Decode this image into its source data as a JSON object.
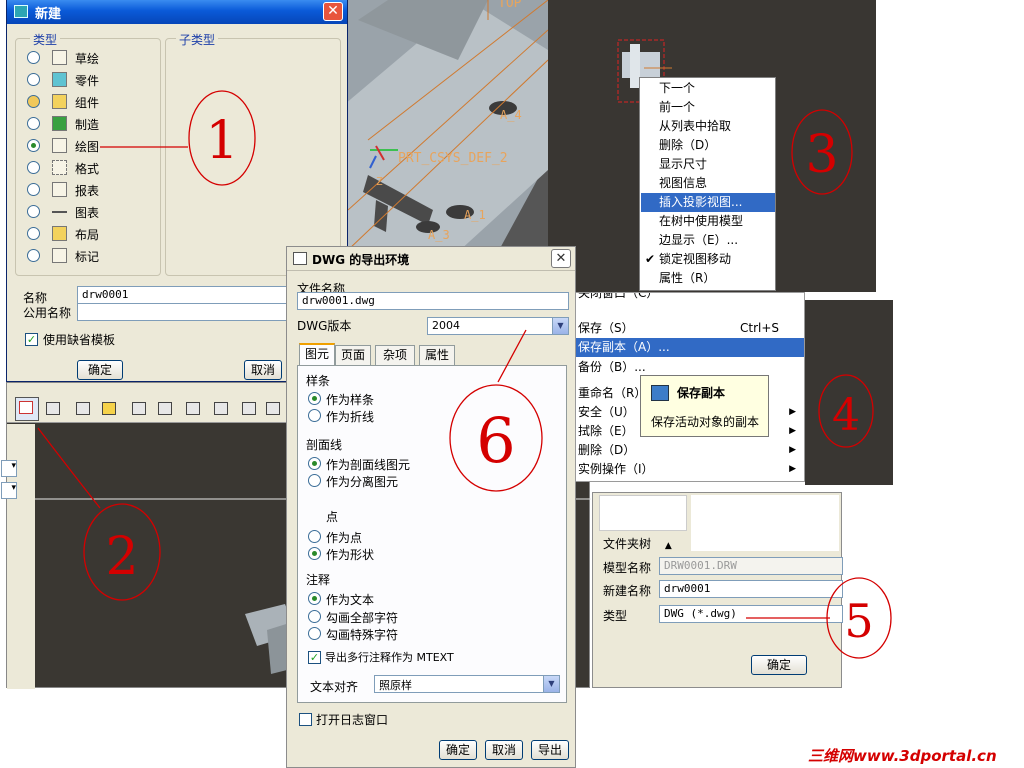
{
  "new_dialog": {
    "title": "新建",
    "type_group": "类型",
    "subtype_group": "子类型",
    "types": [
      "草绘",
      "零件",
      "组件",
      "制造",
      "绘图",
      "格式",
      "报表",
      "图表",
      "布局",
      "标记"
    ],
    "selected_type": "绘图",
    "name_label": "名称",
    "name_value": "drw0001",
    "common_name_label": "公用名称",
    "common_name_value": "",
    "use_template_label": "使用缺省模板",
    "use_template_checked": true,
    "ok": "确定",
    "cancel": "取消"
  },
  "model_view": {
    "labels": [
      "TOP",
      "PRT_CSYS_DEF_2",
      "A_4",
      "A_1",
      "A_3",
      "Z"
    ]
  },
  "context_menu": {
    "items": [
      "下一个",
      "前一个",
      "从列表中拾取",
      "删除（D）",
      "显示尺寸",
      "视图信息",
      "插入投影视图...",
      "在树中使用模型",
      "边显示（E）...",
      "锁定视图移动",
      "属性（R）"
    ],
    "highlighted": "插入投影视图...",
    "checked": "锁定视图移动"
  },
  "dwg_dialog": {
    "title": "DWG 的导出环境",
    "file_name_label": "文件名称",
    "file_name_value": "drw0001.dwg",
    "version_label": "DWG版本",
    "version_value": "2004",
    "tabs": [
      "图元",
      "页面",
      "杂项",
      "属性"
    ],
    "active_tab": "图元",
    "spline_section": "样条",
    "spline_opts": [
      "作为样条",
      "作为折线"
    ],
    "hatch_section": "剖面线",
    "hatch_opts": [
      "作为剖面线图元",
      "作为分离图元"
    ],
    "point_section": "点",
    "point_opts": [
      "作为点",
      "作为形状"
    ],
    "note_section": "注释",
    "note_opts": [
      "作为文本",
      "勾画全部字符",
      "勾画特殊字符"
    ],
    "mtext_label": "导出多行注释作为 MTEXT",
    "mtext_checked": true,
    "align_label": "文本对齐",
    "align_value": "照原样",
    "log_label": "打开日志窗口",
    "log_checked": false,
    "ok": "确定",
    "cancel": "取消",
    "export": "导出"
  },
  "file_menu": {
    "items": [
      {
        "label": "关闭窗口（C）",
        "shortcut": ""
      },
      {
        "label": "保存（S）",
        "shortcut": "Ctrl+S"
      },
      {
        "label": "保存副本（A）...",
        "shortcut": ""
      },
      {
        "label": "备份（B）...",
        "shortcut": ""
      },
      {
        "label": "重命名（R）",
        "shortcut": ""
      },
      {
        "label": "安全（U）",
        "shortcut": ""
      },
      {
        "label": "拭除（E）",
        "shortcut": ""
      },
      {
        "label": "删除（D）",
        "shortcut": ""
      },
      {
        "label": "实例操作（I）",
        "shortcut": ""
      }
    ],
    "highlighted": "保存副本（A）..."
  },
  "tooltip": {
    "title": "保存副本",
    "body": "保存活动对象的副本"
  },
  "save_copy_dialog": {
    "folder_tree": "文件夹树",
    "model_name_label": "模型名称",
    "model_name_value": "DRW0001.DRW",
    "new_name_label": "新建名称",
    "new_name_value": "drw0001",
    "type_label": "类型",
    "type_value": "DWG (*.dwg)",
    "ok": "确定"
  },
  "annotations": [
    "1",
    "2",
    "3",
    "4",
    "5",
    "6"
  ],
  "watermark": "三维网www.3dportal.cn",
  "colors": {
    "annotation": "#d40000",
    "highlight": "#316ac5",
    "dialog_bg": "#ece9d8",
    "model_label": "#e8a45c"
  }
}
